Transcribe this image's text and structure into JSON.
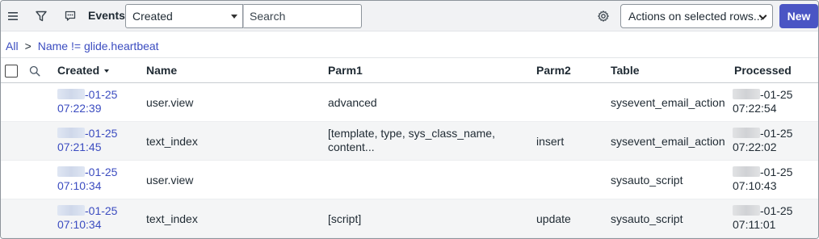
{
  "header": {
    "title": "Events",
    "field_select": "Created",
    "search_placeholder": "Search",
    "actions_select": "Actions on selected rows...",
    "new_label": "New"
  },
  "breadcrumb": {
    "all": "All",
    "separator": ">",
    "filter": "Name != glide.heartbeat"
  },
  "columns": {
    "created": "Created",
    "name": "Name",
    "parm1": "Parm1",
    "parm2": "Parm2",
    "table": "Table",
    "processed": "Processed"
  },
  "rows": [
    {
      "created_date": "-01-25",
      "created_time": "07:22:39",
      "name": "user.view",
      "parm1_l1": "advanced",
      "parm1_l2": "",
      "parm2": "",
      "table": "sysevent_email_action",
      "processed_date": "-01-25",
      "processed_time": "07:22:54"
    },
    {
      "created_date": "-01-25",
      "created_time": "07:21:45",
      "name": "text_index",
      "parm1_l1": "[template, type, sys_class_name,",
      "parm1_l2": "content...",
      "parm2": "insert",
      "table": "sysevent_email_action",
      "processed_date": "-01-25",
      "processed_time": "07:22:02"
    },
    {
      "created_date": "-01-25",
      "created_time": "07:10:34",
      "name": "user.view",
      "parm1_l1": "",
      "parm1_l2": "",
      "parm2": "",
      "table": "sysauto_script",
      "processed_date": "-01-25",
      "processed_time": "07:10:43"
    },
    {
      "created_date": "-01-25",
      "created_time": "07:10:34",
      "name": "text_index",
      "parm1_l1": "[script]",
      "parm1_l2": "",
      "parm2": "update",
      "table": "sysauto_script",
      "processed_date": "-01-25",
      "processed_time": "07:11:01"
    }
  ],
  "colors": {
    "accent": "#4a55c4",
    "link": "#3b4cc0",
    "header_bg": "#f1f2f4",
    "alt_row_bg": "#f4f5f6"
  },
  "icons": [
    "menu-icon",
    "filter-icon",
    "context-menu-icon",
    "gear-icon",
    "search-icon",
    "sort-desc-icon"
  ]
}
